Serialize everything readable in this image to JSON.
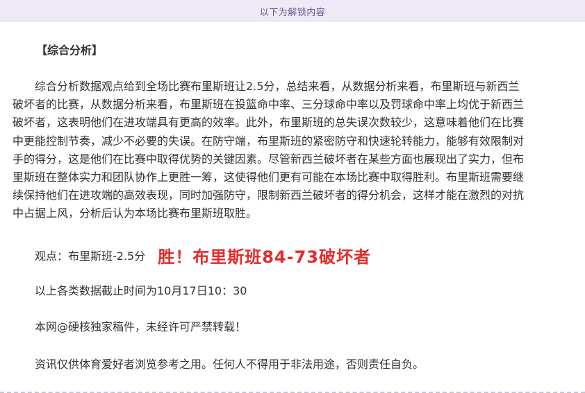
{
  "banner": {
    "text": "以下为解锁内容"
  },
  "article": {
    "section_title": "【综合分析】",
    "paragraph_lines": [
      "综合分析数据观点给到全场比赛布里斯班让2.5分，总结来看，从数据分析来看，布里斯班与新西兰",
      "破坏者的比赛，从数据分析来看，布里斯班在投篮命中率、三分球命中率以及罚球命中率上均优于新西兰",
      "破坏者，这表明他们在进攻端具有更高的效率。此外，布里斯班的总失误次数较少，这意味着他们在比赛",
      "中更能控制节奏，减少不必要的失误。在防守端，布里斯班的紧密防守和快速轮转能力，能够有效限制对",
      "手的得分，这是他们在比赛中取得优势的关键因素。尽管新西兰破坏者在某些方面也展现出了实力，但布",
      "里斯班在整体实力和团队协作上更胜一筹，这使得他们更有可能在本场比赛中取得胜利。布里斯班需要继",
      "续保持他们在进攻端的高效表现，同时加强防守，限制新西兰破坏者的得分机会，这样才能在激烈的对抗",
      "中占据上风，分析后认为本场比赛布里斯班取胜。"
    ],
    "viewpoint_label": "观点：布里斯班-2.5分",
    "viewpoint_result": "胜！布里斯班84-73破坏者",
    "data_cutoff": "以上各类数据截止时间为10月17日10：30",
    "copyright": "本网@硬核独家稿件，未经许可严禁转载！",
    "disclaimer": "资讯仅供体育爱好者浏览参考之用。任何人不得用于非法用途，否则责任自负。"
  },
  "colors": {
    "banner_bg": "#ede9f7",
    "banner_text": "#6a5a8e",
    "highlight_red": "#e62b2b",
    "body_text": "#333333"
  }
}
